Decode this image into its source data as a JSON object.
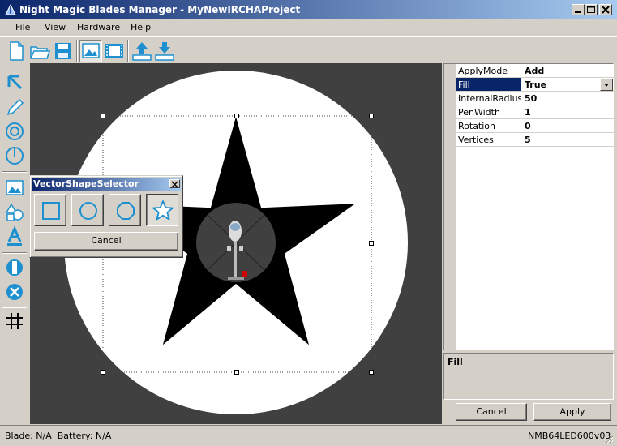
{
  "window": {
    "title": "Night Magic Blades Manager - MyNewIRCHAProject",
    "titlebar_color": "#0a246a"
  },
  "menu": {
    "items": [
      "File",
      "View",
      "Hardware",
      "Help"
    ]
  },
  "toolbar": {
    "buttons": [
      "new-file-icon",
      "open-folder-icon",
      "save-disk-icon",
      "image-view-icon",
      "film-view-icon",
      "upload-icon",
      "download-icon"
    ]
  },
  "tools": {
    "buttons": [
      "pointer-arrow-icon",
      "pencil-icon",
      "ring-icon",
      "clock-line-icon",
      "image-insert-icon",
      "shapes-icon",
      "text-icon",
      "rotate-icon",
      "delete-icon",
      "grid-icon"
    ]
  },
  "properties": {
    "rows": [
      {
        "name": "ApplyMode",
        "value": "Add"
      },
      {
        "name": "Fill",
        "value": "True"
      },
      {
        "name": "InternalRadius",
        "value": "50"
      },
      {
        "name": "PenWidth",
        "value": "1"
      },
      {
        "name": "Rotation",
        "value": "0"
      },
      {
        "name": "Vertices",
        "value": "5"
      }
    ],
    "selected": "Fill",
    "description_title": "Fill"
  },
  "actions": {
    "cancel_label": "Cancel",
    "apply_label": "Apply"
  },
  "dialog": {
    "title": "VectorShapeSelector",
    "shapes": [
      "square-shape-icon",
      "circle-shape-icon",
      "octagon-shape-icon",
      "star-shape-icon"
    ],
    "selected_shape": "star",
    "cancel_label": "Cancel"
  },
  "status": {
    "left": "Blade: N/A  Battery: N/A",
    "right": "NMB64LED600v03"
  },
  "colors": {
    "canvas_bg": "#404040",
    "accent": "#1e90d0",
    "selection": "#0a246a"
  }
}
